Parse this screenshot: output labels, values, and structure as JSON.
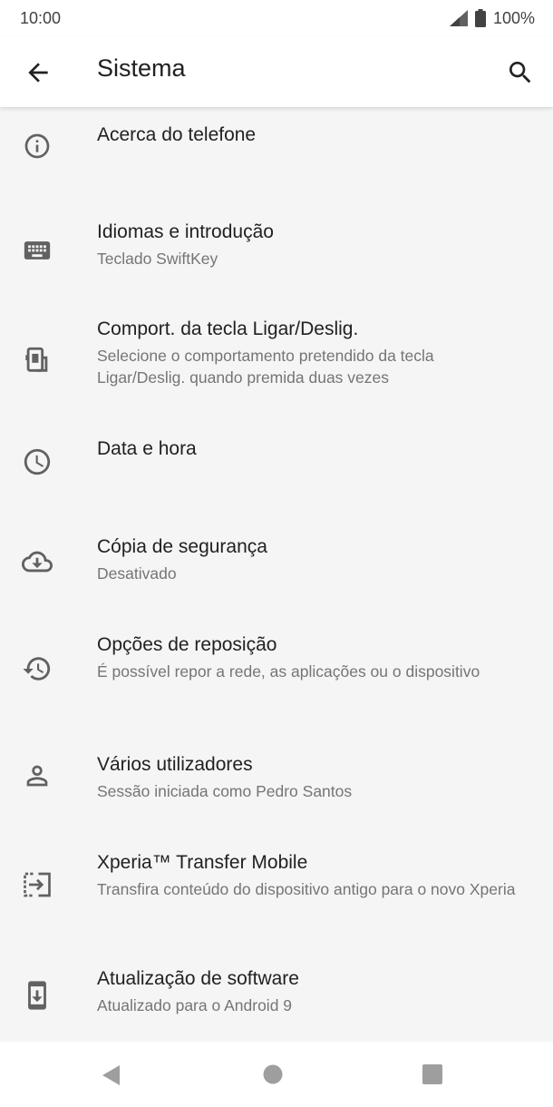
{
  "status_bar": {
    "time": "10:00",
    "battery": "100%",
    "icons": [
      "signal-icon",
      "battery-icon"
    ]
  },
  "app_bar": {
    "title": "Sistema",
    "back_icon": "arrow-left-icon",
    "search_icon": "search-icon"
  },
  "items": [
    {
      "icon": "info-icon",
      "title": "Acerca do telefone",
      "subtitle": ""
    },
    {
      "icon": "keyboard-icon",
      "title": "Idiomas e introdução",
      "subtitle": "Teclado SwiftKey"
    },
    {
      "icon": "power-key-icon",
      "title": "Comport. da tecla Ligar/Deslig.",
      "subtitle": "Selecione o comportamento pretendido da tecla Ligar/Deslig. quando premida duas vezes"
    },
    {
      "icon": "clock-icon",
      "title": "Data e hora",
      "subtitle": ""
    },
    {
      "icon": "cloud-backup-icon",
      "title": "Cópia de segurança",
      "subtitle": "Desativado"
    },
    {
      "icon": "history-icon",
      "title": "Opções de reposição",
      "subtitle": "É possível repor a rede, as aplicações ou o dispositivo"
    },
    {
      "icon": "person-icon",
      "title": "Vários utilizadores",
      "subtitle": "Sessão iniciada como Pedro Santos"
    },
    {
      "icon": "transfer-icon",
      "title": "Xperia™ Transfer Mobile",
      "subtitle": "Transfira conteúdo do dispositivo antigo para o novo Xperia"
    },
    {
      "icon": "system-update-icon",
      "title": "Atualização de software",
      "subtitle": "Atualizado para o Android 9"
    }
  ],
  "nav_bar": {
    "icons": [
      "back-triangle-icon",
      "home-circle-icon",
      "recents-square-icon"
    ]
  },
  "colors": {
    "background": "#f5f5f5",
    "surface": "#ffffff",
    "primary_text": "#212121",
    "secondary_text": "#757575",
    "icon": "#616161"
  }
}
